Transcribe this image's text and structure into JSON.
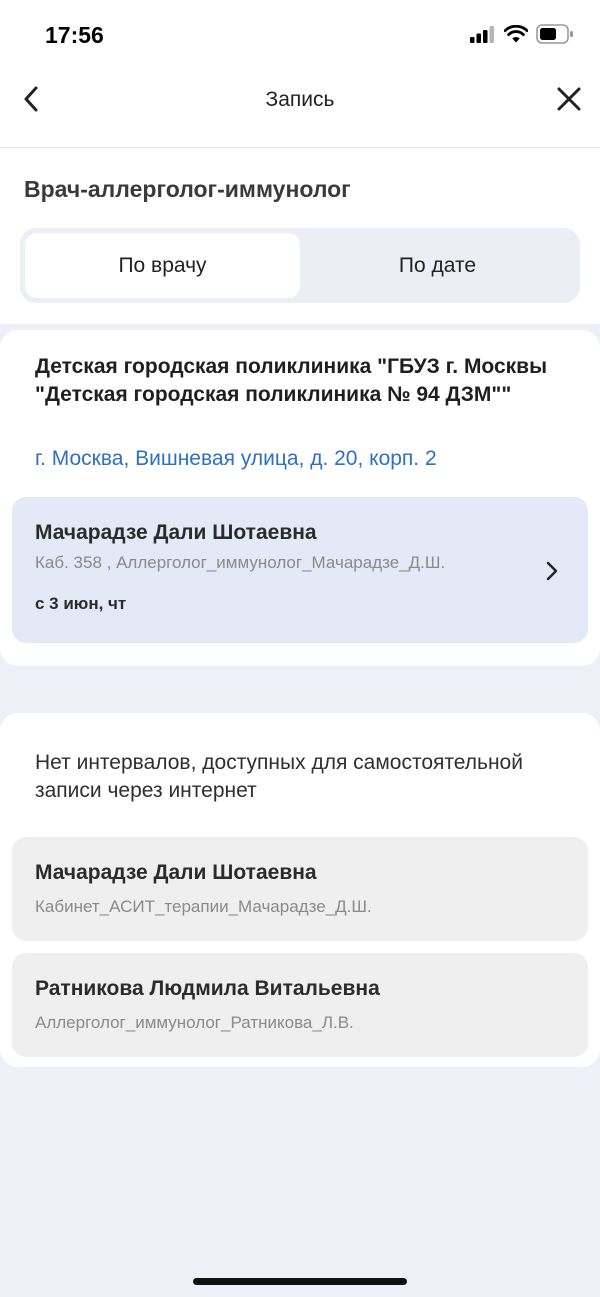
{
  "status_bar": {
    "time": "17:56"
  },
  "nav": {
    "title": "Запись",
    "back_icon": "chevron-left-icon",
    "close_icon": "close-icon"
  },
  "specialty": "Врач-аллерголог-иммунолог",
  "tabs": [
    {
      "label": "По врачу",
      "active": true
    },
    {
      "label": "По дате",
      "active": false
    }
  ],
  "clinic": {
    "name": "Детская городская поликлиника \"ГБУЗ г. Москвы \"Детская городская поликлиника № 94 ДЗМ\"\"",
    "address": "г. Москва, Вишневая улица, д. 20, корп. 2"
  },
  "available_doctors": [
    {
      "name": "Мачарадзе Дали Шотаевна",
      "room": "Каб. 358 , Аллерголог_иммунолог_Мачарадзе_Д.Ш.",
      "date": "с 3 июн, чт"
    }
  ],
  "unavailable": {
    "message": "Нет интервалов, доступных для самостоятельной записи через интернет",
    "doctors": [
      {
        "name": "Мачарадзе Дали Шотаевна",
        "room": "Кабинет_АСИТ_терапии_Мачарадзе_Д.Ш."
      },
      {
        "name": "Ратникова Людмила Витальевна",
        "room": "Аллерголог_иммунолог_Ратникова_Л.В."
      }
    ]
  },
  "colors": {
    "accent_link": "#2f6fc4",
    "active_tile": "#e3e9f6",
    "inactive_tile": "#efefef",
    "page_bg": "#eef0f7"
  }
}
